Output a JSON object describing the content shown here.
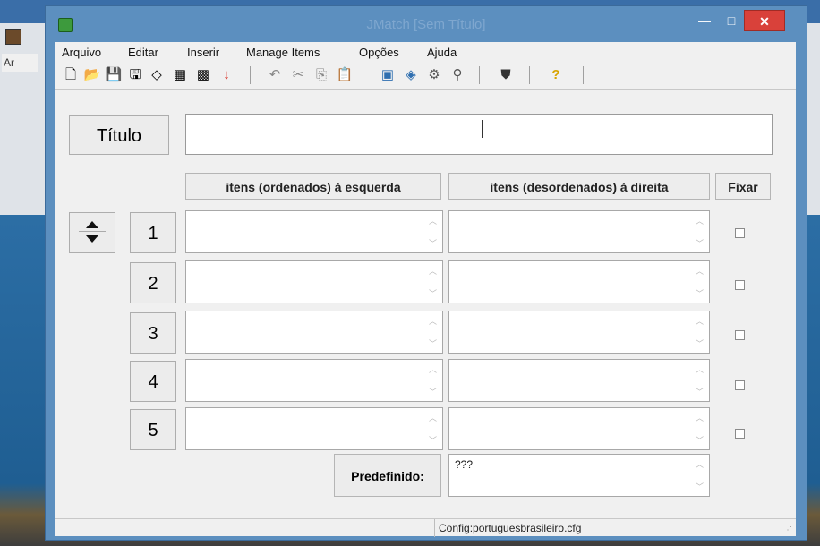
{
  "window": {
    "title": "JMatch [Sem Título]",
    "minimize_glyph": "—",
    "maximize_glyph": "□",
    "close_glyph": "✕",
    "behind_label": "Ar"
  },
  "menu": [
    "Arquivo",
    "Editar",
    "Inserir",
    "Manage Items",
    "Opções",
    "Ajuda"
  ],
  "toolbar_icons": [
    {
      "name": "new-file-icon",
      "glyph": "🗋"
    },
    {
      "name": "open-folder-icon",
      "glyph": "📂"
    },
    {
      "name": "save-icon",
      "glyph": "💾"
    },
    {
      "name": "save-as-icon",
      "glyph": "🖫"
    },
    {
      "name": "eraser-icon",
      "glyph": "◇"
    },
    {
      "name": "export-web-icon",
      "glyph": "▦"
    },
    {
      "name": "export-print-icon",
      "glyph": "▩"
    },
    {
      "name": "arrow-down-icon",
      "glyph": "↓"
    },
    {
      "name": "undo-icon",
      "glyph": "↶"
    },
    {
      "name": "cut-icon",
      "glyph": "✂"
    },
    {
      "name": "copy-icon",
      "glyph": "⎘"
    },
    {
      "name": "paste-icon",
      "glyph": "📋"
    },
    {
      "name": "config-icon",
      "glyph": "▣"
    },
    {
      "name": "globe-icon",
      "glyph": "◈"
    },
    {
      "name": "spell-check-icon",
      "glyph": "⚙"
    },
    {
      "name": "search-replace-icon",
      "glyph": "⚲"
    },
    {
      "name": "shield-icon",
      "glyph": "⛊"
    },
    {
      "name": "help-icon",
      "glyph": "?"
    }
  ],
  "title_button": "Título",
  "title_value": "",
  "headers": {
    "left": "itens (ordenados) à esquerda",
    "right": "itens (desordenados) à direita",
    "fix": "Fixar"
  },
  "rows": [
    {
      "number": "1",
      "left": "",
      "right": "",
      "fixed": false
    },
    {
      "number": "2",
      "left": "",
      "right": "",
      "fixed": false
    },
    {
      "number": "3",
      "left": "",
      "right": "",
      "fixed": false
    },
    {
      "number": "4",
      "left": "",
      "right": "",
      "fixed": false
    },
    {
      "number": "5",
      "left": "",
      "right": "",
      "fixed": false
    }
  ],
  "predefined": {
    "label": "Predefinido:",
    "value": "???"
  },
  "status": "Config:portuguesbrasileiro.cfg",
  "colors": {
    "close_button": "#d9413a",
    "window_frame": "#5c8fbf",
    "help_icon": "#d8a400",
    "arrow_icon": "#d62a1e"
  }
}
